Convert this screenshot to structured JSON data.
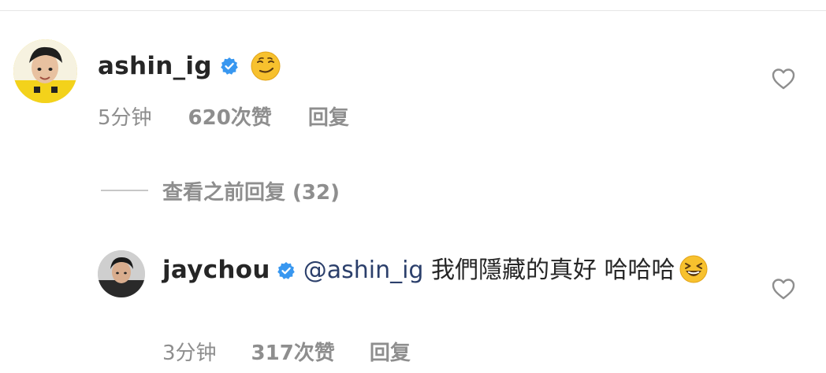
{
  "comments": [
    {
      "username": "ashin_ig",
      "time": "5分钟",
      "likes": "620次赞",
      "reply": "回复"
    },
    {
      "username": "jaychou",
      "mention": "@ashin_ig",
      "text": " 我們隱藏的真好 哈哈哈",
      "time": "3分钟",
      "likes": "317次赞",
      "reply": "回复"
    }
  ],
  "view_replies": {
    "label": "查看之前回复 (32)"
  },
  "colors": {
    "verified": "#3897f0",
    "meta_text": "#8e8e8e",
    "primary_text": "#262626",
    "mention": "#2b3f6b",
    "emoji": "#f7c12e"
  },
  "icons": {
    "verified": "verified-badge-icon",
    "like": "heart-outline-icon",
    "emoji_1": "smirk-emoji",
    "emoji_2": "laughing-emoji"
  }
}
